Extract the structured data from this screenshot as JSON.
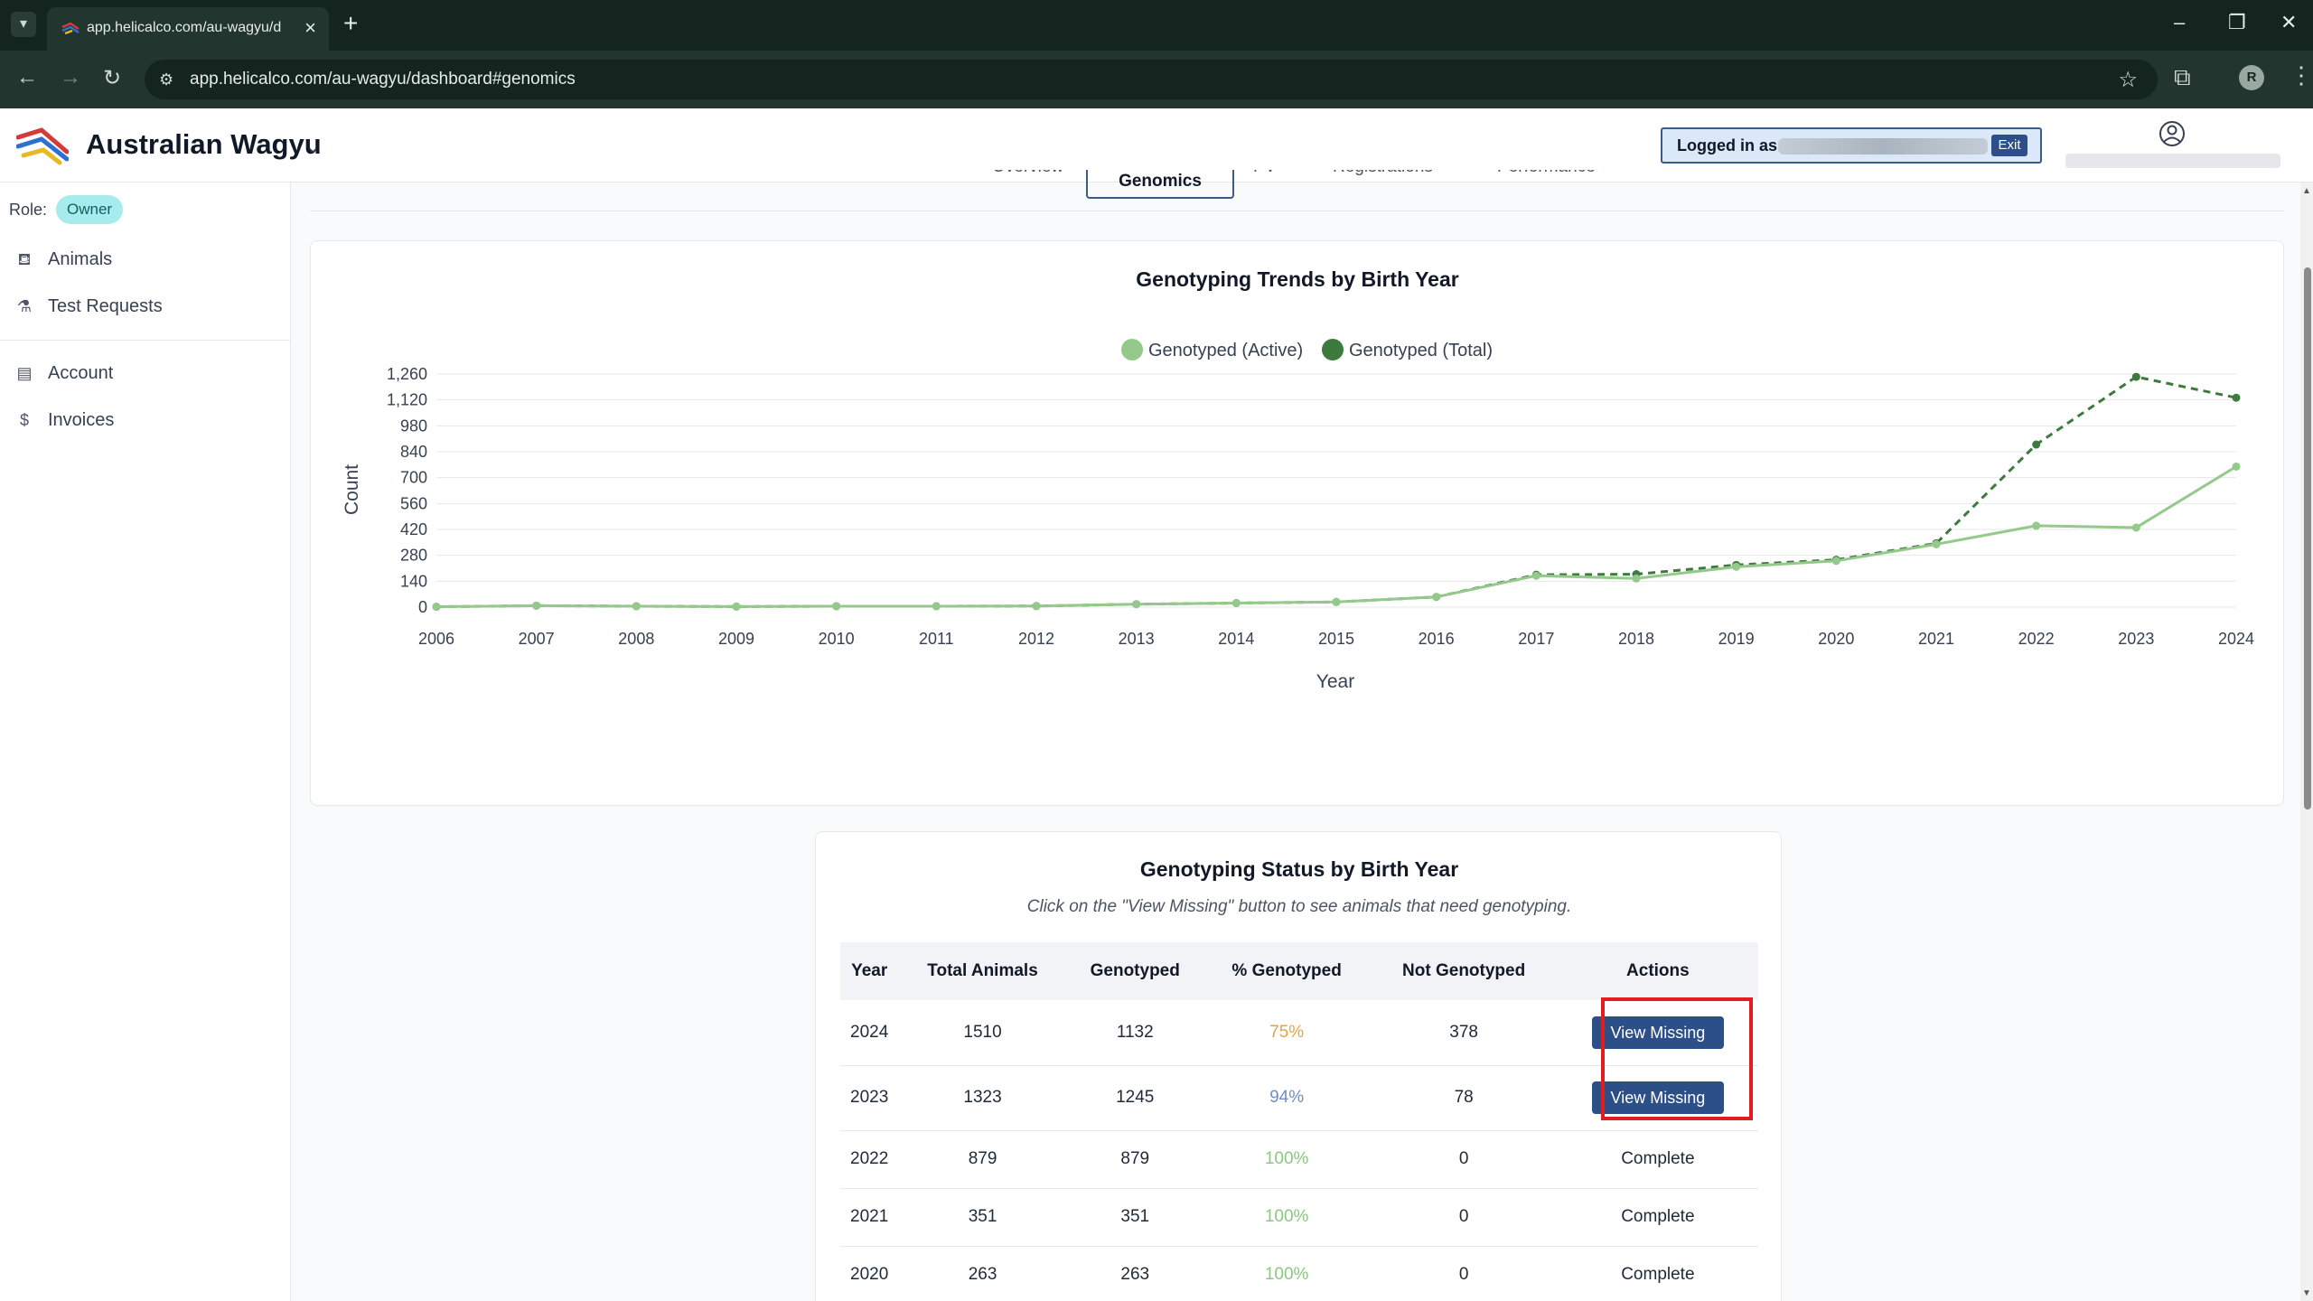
{
  "browser": {
    "tab_title": "app.helicalco.com/au-wagyu/d",
    "url": "app.helicalco.com/au-wagyu/dashboard#genomics",
    "profile_initial": "R"
  },
  "header": {
    "app_title": "Australian Wagyu",
    "logged_in_label": "Logged in as",
    "exit_label": "Exit"
  },
  "sidebar": {
    "role_label": "Role:",
    "role_value": "Owner",
    "items": [
      {
        "label": "Animals",
        "icon": "cow-icon"
      },
      {
        "label": "Test Requests",
        "icon": "flask-icon"
      },
      {
        "label": "Account",
        "icon": "id-card-icon"
      },
      {
        "label": "Invoices",
        "icon": "dollar-icon"
      }
    ]
  },
  "page_tabs": [
    {
      "label": "Overview"
    },
    {
      "label": "Genomics",
      "active": true
    },
    {
      "label": "PV"
    },
    {
      "label": "Registrations"
    },
    {
      "label": "Performance"
    }
  ],
  "chart_data": {
    "type": "line",
    "title": "Genotyping Trends by Birth Year",
    "xlabel": "Year",
    "ylabel": "Count",
    "x": [
      2006,
      2007,
      2008,
      2009,
      2010,
      2011,
      2012,
      2013,
      2014,
      2015,
      2016,
      2017,
      2018,
      2019,
      2020,
      2021,
      2022,
      2023,
      2024
    ],
    "ylim": [
      0,
      1300
    ],
    "yticks": [
      0,
      140,
      280,
      420,
      560,
      700,
      840,
      980,
      1120,
      1260
    ],
    "ytick_labels": [
      "0",
      "140",
      "280",
      "420",
      "560",
      "700",
      "840",
      "980",
      "1,120",
      "1,260"
    ],
    "legend_position": "top-center",
    "grid": true,
    "series": [
      {
        "name": "Genotyped (Active)",
        "color": "#94c98b",
        "style": "solid",
        "values": [
          2,
          8,
          5,
          3,
          5,
          5,
          6,
          16,
          22,
          28,
          55,
          170,
          155,
          218,
          250,
          340,
          440,
          430,
          760
        ]
      },
      {
        "name": "Genotyped (Total)",
        "color": "#3d7a3d",
        "style": "dashed",
        "values": [
          2,
          8,
          5,
          3,
          5,
          5,
          6,
          16,
          22,
          28,
          55,
          175,
          178,
          228,
          256,
          345,
          879,
          1245,
          1132
        ]
      }
    ]
  },
  "status_table": {
    "title": "Genotyping Status by Birth Year",
    "subtitle": "Click on the \"View Missing\" button to see animals that need genotyping.",
    "columns": [
      "Year",
      "Total Animals",
      "Genotyped",
      "% Genotyped",
      "Not Genotyped",
      "Actions"
    ],
    "rows": [
      {
        "year": "2024",
        "total": "1510",
        "genotyped": "1132",
        "pct": "75%",
        "not": "378",
        "action": "View Missing"
      },
      {
        "year": "2023",
        "total": "1323",
        "genotyped": "1245",
        "pct": "94%",
        "not": "78",
        "action": "View Missing"
      },
      {
        "year": "2022",
        "total": "879",
        "genotyped": "879",
        "pct": "100%",
        "not": "0",
        "action": "Complete"
      },
      {
        "year": "2021",
        "total": "351",
        "genotyped": "351",
        "pct": "100%",
        "not": "0",
        "action": "Complete"
      },
      {
        "year": "2020",
        "total": "263",
        "genotyped": "263",
        "pct": "100%",
        "not": "0",
        "action": "Complete"
      }
    ]
  },
  "colors": {
    "accent": "#2b4f86",
    "highlight": "#e11d1d",
    "pct_warn": "#e3a541",
    "pct_mid": "#6d8fc0",
    "pct_ok": "#8bc780"
  }
}
